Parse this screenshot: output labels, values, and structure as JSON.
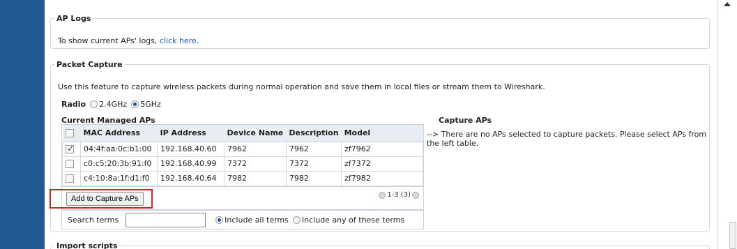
{
  "ap_logs": {
    "legend": "AP Logs",
    "text": "To show current APs' logs, ",
    "link": "click here",
    "suffix": "."
  },
  "packet_capture": {
    "legend": "Packet Capture",
    "description": "Use this feature to capture wireless packets during normal operation and save them in local files or stream them to Wireshark.",
    "radio_label": "Radio",
    "radio_options": [
      "2.4GHz",
      "5GHz"
    ],
    "radio_selected": "5GHz",
    "current_label": "Current Managed APs",
    "capture_label": "Capture APs",
    "columns": [
      "MAC Address",
      "IP Address",
      "Device Name",
      "Description",
      "Model"
    ],
    "rows": [
      {
        "checked": true,
        "mac": "04:4f:aa:0c:b1:00",
        "ip": "192.168.40.60",
        "name": "7962",
        "desc": "7962",
        "model": "zf7962"
      },
      {
        "checked": false,
        "mac": "c0:c5:20:3b:91:f0",
        "ip": "192.168.40.99",
        "name": "7372",
        "desc": "7372",
        "model": "zf7372"
      },
      {
        "checked": false,
        "mac": "c4:10:8a:1f:d1:f0",
        "ip": "192.168.40.64",
        "name": "7982",
        "desc": "7982",
        "model": "zf7982"
      }
    ],
    "add_button": "Add to Capture APs",
    "pager": "1-3 (3)",
    "search_label": "Search terms",
    "search_value": "",
    "search_mode_options": [
      "Include all terms",
      "Include any of these terms"
    ],
    "search_mode_selected": "Include all terms",
    "no_aps_text": "--> There are no APs selected to capture packets. Please select APs from the left table."
  },
  "import_scripts": {
    "legend": "Import scripts"
  },
  "colors": {
    "left_bar": "#1f5a94",
    "highlight": "#d61f1f",
    "link": "#1f5aa8"
  }
}
